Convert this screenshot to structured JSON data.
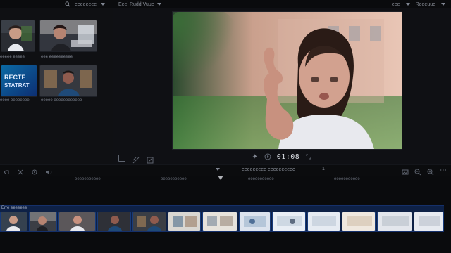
{
  "colors": {
    "accent": "#2d5bff",
    "timeline": "#0e2146"
  },
  "topbar": {
    "left_icon": "search-icon",
    "left_text": "eeeeeeee",
    "center_text": "Eeeʼ Rudd Vuue",
    "right_text_1": "eee",
    "right_text_2": "Reeeuue"
  },
  "browser": {
    "clips": [
      {
        "caption": "eeeee eeeee"
      },
      {
        "caption": "eee eeeeeeeeee"
      },
      {
        "caption": "eeee eeeeeeee",
        "tile_text": "RECTE\nSTATRAT"
      },
      {
        "caption": "eeeee eeeeeeeeeeee"
      }
    ]
  },
  "viewer": {
    "timecode": "01:08"
  },
  "timeline": {
    "header_title": "eeeeeeeee eeeeeeeeee",
    "header_num": "1",
    "ruler_labels": [
      "eeeeeeeeeee",
      "eeeeeeeeeee",
      "eeeeeeeeeee",
      "eeeeeeeeeee"
    ],
    "track_label": "Erre eeeeeee"
  }
}
